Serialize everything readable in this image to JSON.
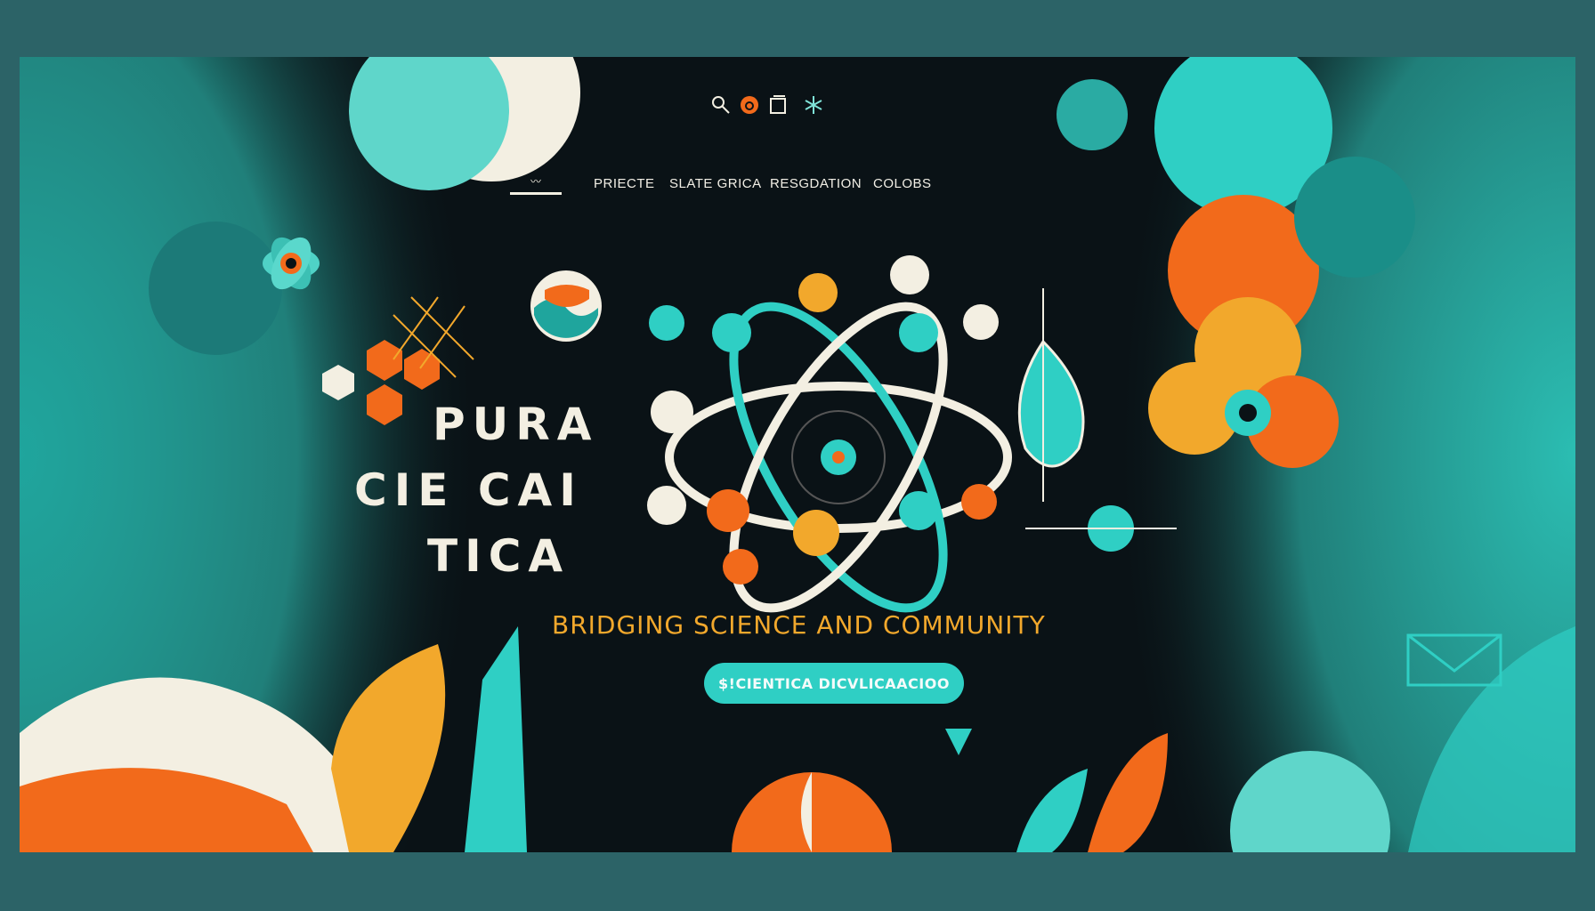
{
  "nav": {
    "items": [
      {
        "label": "PRIECTE"
      },
      {
        "label": "SLATE GRICA"
      },
      {
        "label": "RESGDATION"
      },
      {
        "label": "COLOBS"
      }
    ]
  },
  "top_icons": [
    "search-icon",
    "record-icon",
    "document-icon",
    "snowflake-icon"
  ],
  "hero": {
    "title_lines": [
      "PURA",
      "CIE CAI",
      "TICA"
    ],
    "tagline": "BRIDGING SCIENCE AND COMMUNITY",
    "cta_label": "$!CIENTICA DICVLICAACIOO"
  },
  "colors": {
    "frame": "#2c6367",
    "background": "#0a1216",
    "teal": "#2fcfc4",
    "orange": "#f26a1b",
    "yellow": "#f2a82c",
    "cream": "#f3efe2"
  }
}
